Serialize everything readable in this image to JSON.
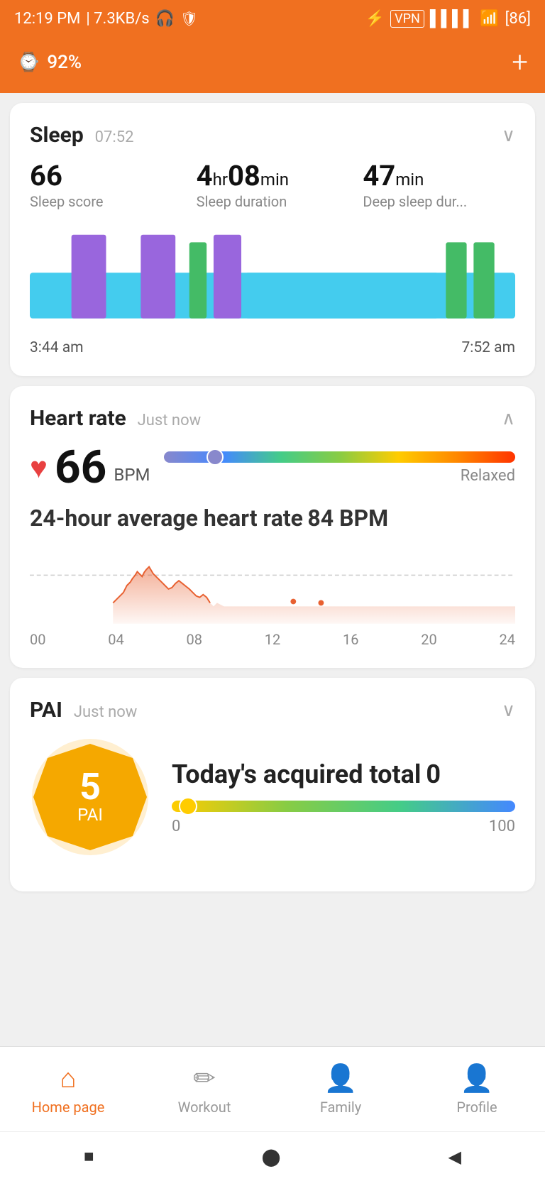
{
  "statusBar": {
    "time": "12:19 PM",
    "network": "7.3KB/s",
    "batteryPercent": "86"
  },
  "header": {
    "devicePercent": "92%",
    "addButton": "+"
  },
  "sleep": {
    "title": "Sleep",
    "time": "07:52",
    "scoreValue": "66",
    "scoreLabel": "Sleep score",
    "durationHr": "4",
    "durationMin": "08",
    "durationLabel": "Sleep duration",
    "deepSleepMin": "47",
    "deepSleepLabel": "Deep sleep dur...",
    "startTime": "3:44 am",
    "endTime": "7:52 am"
  },
  "heartRate": {
    "title": "Heart rate",
    "when": "Just now",
    "bpm": "66",
    "bpmUnit": "BPM",
    "status": "Relaxed",
    "avgLabel": "24-hour average heart rate",
    "avgValue": "84",
    "avgUnit": "BPM",
    "timeLabels": [
      "00",
      "04",
      "08",
      "12",
      "16",
      "20",
      "24"
    ]
  },
  "pai": {
    "title": "PAI",
    "when": "Just now",
    "value": "5",
    "label": "PAI",
    "acquiredLabel": "Today's acquired total",
    "acquiredValue": "0",
    "rangeMin": "0",
    "rangeMax": "100"
  },
  "bottomNav": {
    "items": [
      {
        "id": "home",
        "label": "Home page",
        "active": true
      },
      {
        "id": "workout",
        "label": "Workout",
        "active": false
      },
      {
        "id": "family",
        "label": "Family",
        "active": false
      },
      {
        "id": "profile",
        "label": "Profile",
        "active": false
      }
    ]
  }
}
